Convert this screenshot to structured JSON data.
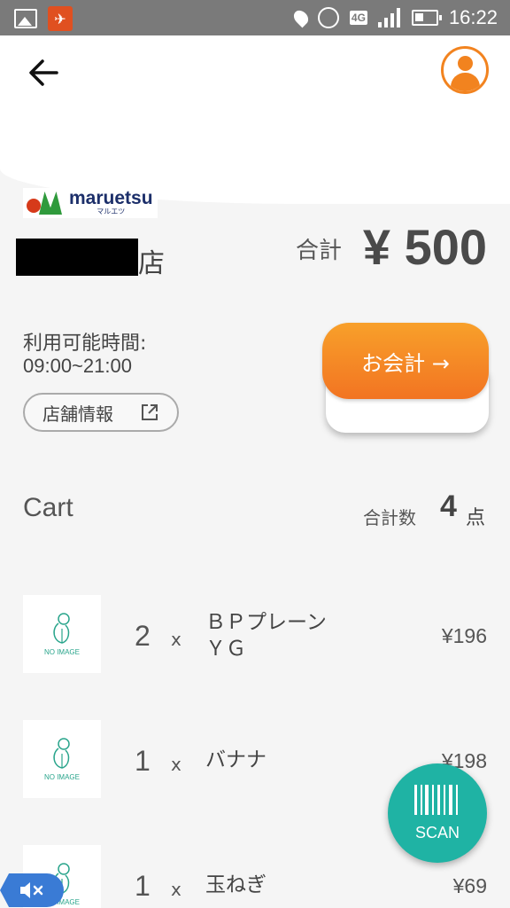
{
  "status_bar": {
    "time": "16:22",
    "network": "4G",
    "icons": [
      "image-icon",
      "app-notification-icon",
      "location-icon",
      "alarm-icon",
      "signal-icon",
      "battery-icon"
    ]
  },
  "header": {
    "back_icon": "arrow-left-icon",
    "profile_icon": "user-avatar-icon",
    "accent_color": "#f2831f"
  },
  "store": {
    "logo_text": "maruetsu",
    "logo_sub": "マルエツ",
    "name_suffix": "店",
    "total_label": "合計",
    "total_amount": "¥ 500",
    "hours_label": "利用可能時間:",
    "hours_value": "09:00~21:00",
    "info_button": "店舗情報",
    "checkout_button": "お会計 →"
  },
  "cart": {
    "title": "Cart",
    "count_label": "合計数",
    "count_value": "4",
    "count_unit": "点",
    "items": [
      {
        "qty": "2",
        "x": "x",
        "name": "ＢＰプレーンＹＧ",
        "price": "¥196",
        "image_text": "NO IMAGE"
      },
      {
        "qty": "1",
        "x": "x",
        "name": "バナナ",
        "price": "¥198",
        "image_text": "NO IMAGE"
      },
      {
        "qty": "1",
        "x": "x",
        "name": "玉ねぎ",
        "price": "¥69",
        "image_text": "NO IMAGE"
      }
    ]
  },
  "scan_button": {
    "label": "SCAN",
    "color": "#1fb3a4"
  },
  "mute_badge": {
    "icon": "speaker-muted-icon"
  }
}
